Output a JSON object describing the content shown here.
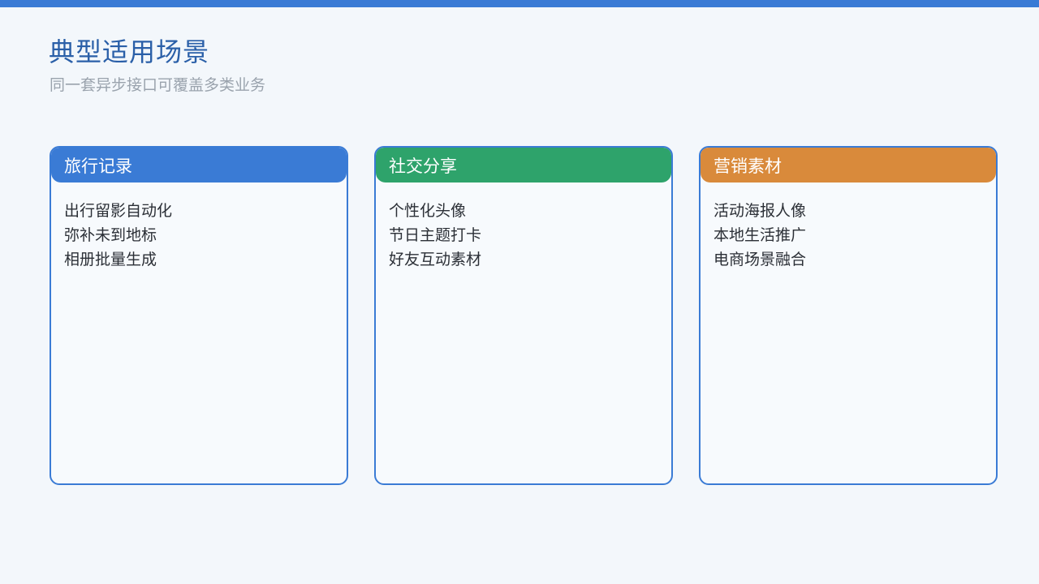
{
  "theme": {
    "accent": "#3a7bd5",
    "title_color": "#2a5fa8",
    "card_border": "#3a7bd5"
  },
  "header": {
    "title": "典型适用场景",
    "subtitle": "同一套异步接口可覆盖多类业务"
  },
  "cards": [
    {
      "title": "旅行记录",
      "color": "#3a7bd5",
      "items": [
        "出行留影自动化",
        "弥补未到地标",
        "相册批量生成"
      ]
    },
    {
      "title": "社交分享",
      "color": "#2ea36b",
      "items": [
        "个性化头像",
        "节日主题打卡",
        "好友互动素材"
      ]
    },
    {
      "title": "营销素材",
      "color": "#d98a3b",
      "items": [
        "活动海报人像",
        "本地生活推广",
        "电商场景融合"
      ]
    }
  ]
}
